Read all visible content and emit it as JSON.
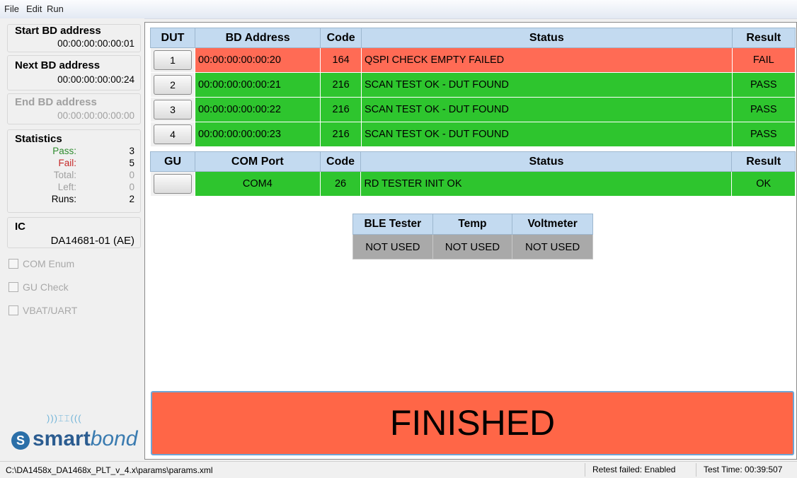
{
  "menu": [
    "File",
    "Edit",
    "Run"
  ],
  "left": {
    "start": {
      "title": "Start BD address",
      "value": "00:00:00:00:00:01"
    },
    "next": {
      "title": "Next BD address",
      "value": "00:00:00:00:00:24"
    },
    "end": {
      "title": "End BD address",
      "value": "00:00:00:00:00:00"
    },
    "stats": {
      "title": "Statistics",
      "rows": [
        {
          "label": "Pass:",
          "value": "3",
          "color": "#2e8b2e"
        },
        {
          "label": "Fail:",
          "value": "5",
          "color": "#c62828"
        },
        {
          "label": "Total:",
          "value": "0",
          "color": "#a0a0a0"
        },
        {
          "label": "Left:",
          "value": "0",
          "color": "#a0a0a0"
        },
        {
          "label": "Runs:",
          "value": "2",
          "color": "#000000"
        }
      ]
    },
    "ic": {
      "title": "IC",
      "value": "DA14681-01 (AE)"
    },
    "checks": [
      "COM Enum",
      "GU Check",
      "VBAT/UART"
    ],
    "logo": {
      "smart": "smart",
      "bond": "bond"
    }
  },
  "dut_table": {
    "headers": [
      "DUT",
      "BD Address",
      "Code",
      "Status",
      "Result"
    ],
    "rows": [
      {
        "dut": "1",
        "address": "00:00:00:00:00:20",
        "code": "164",
        "status": "QSPI CHECK EMPTY FAILED",
        "result": "FAIL"
      },
      {
        "dut": "2",
        "address": "00:00:00:00:00:21",
        "code": "216",
        "status": "SCAN TEST OK - DUT FOUND",
        "result": "PASS"
      },
      {
        "dut": "3",
        "address": "00:00:00:00:00:22",
        "code": "216",
        "status": "SCAN TEST OK - DUT FOUND",
        "result": "PASS"
      },
      {
        "dut": "4",
        "address": "00:00:00:00:00:23",
        "code": "216",
        "status": "SCAN TEST OK - DUT FOUND",
        "result": "PASS"
      }
    ]
  },
  "gu_table": {
    "headers": [
      "GU",
      "COM Port",
      "Code",
      "Status",
      "Result"
    ],
    "row": {
      "gu": "",
      "port": "COM4",
      "code": "26",
      "status": "RD TESTER INIT OK",
      "result": "OK"
    }
  },
  "instruments": {
    "headers": [
      "BLE Tester",
      "Temp",
      "Voltmeter"
    ],
    "values": [
      "NOT USED",
      "NOT USED",
      "NOT USED"
    ]
  },
  "finished": "FINISHED",
  "statusbar": {
    "path": "C:\\DA1458x_DA1468x_PLT_v_4.x\\params\\params.xml",
    "retest": "Retest failed: Enabled",
    "test_time": "Test Time: 00:39:507"
  },
  "colors": {
    "fail": "#ff6b55",
    "pass": "#2ec52e",
    "header": "#c3daf0",
    "finished": "#ff6647"
  }
}
